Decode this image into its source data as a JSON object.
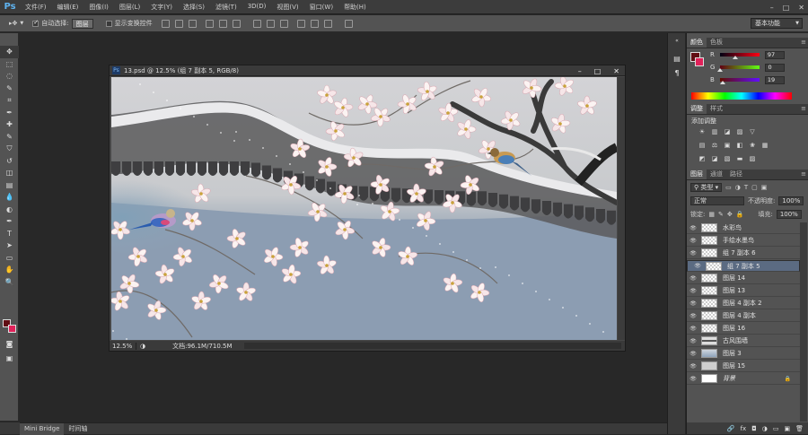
{
  "app": {
    "logo": "Ps"
  },
  "menu": [
    "文件(F)",
    "编辑(E)",
    "图像(I)",
    "图层(L)",
    "文字(Y)",
    "选择(S)",
    "滤镜(T)",
    "3D(D)",
    "视图(V)",
    "窗口(W)",
    "帮助(H)"
  ],
  "window_controls": {
    "minimize": "–",
    "maximize": "□",
    "close": "✕"
  },
  "options": {
    "auto_select_label": "自动选择:",
    "auto_select_value": "图层",
    "show_transform_label": "显示变换控件",
    "workspace": "基本功能"
  },
  "document": {
    "title": "13.psd @ 12.5% (组 7 副本 5, RGB/8)",
    "zoom": "12.5%",
    "info": "文档:96.1M/710.5M",
    "controls": {
      "minimize": "–",
      "maximize": "□",
      "close": "✕"
    }
  },
  "colors": {
    "foreground": "#610d13",
    "background": "#e0225a",
    "panel_bg": "#535353",
    "selected_layer": "#5b6b82"
  },
  "color_panel": {
    "tabs": [
      "颜色",
      "色板"
    ],
    "channels": [
      {
        "label": "R",
        "value": "97",
        "level": 0.38
      },
      {
        "label": "G",
        "value": "0",
        "level": 0.0
      },
      {
        "label": "B",
        "value": "19",
        "level": 0.07
      }
    ]
  },
  "adjust_panel": {
    "tabs": [
      "调整",
      "样式"
    ],
    "title": "添加调整",
    "row1": [
      "☀",
      "▥",
      "◪",
      "▨",
      "▽"
    ],
    "row2": [
      "▤",
      "⚖",
      "▣",
      "◧",
      "❀",
      "▦"
    ],
    "row3": [
      "◩",
      "◪",
      "▧",
      "▬",
      "▨"
    ]
  },
  "layers_panel": {
    "tabs": [
      "图层",
      "通道",
      "路径"
    ],
    "filter_label": "类型",
    "blend_mode": "正常",
    "opacity_label": "不透明度:",
    "opacity_value": "100%",
    "lock_label": "锁定:",
    "fill_label": "填充:",
    "fill_value": "100%",
    "layers": [
      {
        "name": "水彩鸟",
        "selected": false,
        "thumb": "checker"
      },
      {
        "name": "手绘水墨鸟",
        "selected": false,
        "thumb": "checker"
      },
      {
        "name": "组 7 副本 6",
        "selected": false,
        "thumb": "checker"
      },
      {
        "name": "组 7 副本 5",
        "selected": true,
        "thumb": "checker"
      },
      {
        "name": "图层 14",
        "selected": false,
        "thumb": "checker"
      },
      {
        "name": "图层 13",
        "selected": false,
        "thumb": "checker"
      },
      {
        "name": "图层 4 副本 2",
        "selected": false,
        "thumb": "checker"
      },
      {
        "name": "图层 4 副本",
        "selected": false,
        "thumb": "checker"
      },
      {
        "name": "图层 16",
        "selected": false,
        "thumb": "checker"
      },
      {
        "name": "古风围墙",
        "selected": false,
        "thumb": "wall"
      },
      {
        "name": "图层 3",
        "selected": false,
        "thumb": "blue"
      },
      {
        "name": "图层 15",
        "selected": false,
        "thumb": "gray"
      },
      {
        "name": "背景",
        "selected": false,
        "thumb": "white",
        "italic": true,
        "locked": true
      }
    ],
    "bottom_icons": [
      "🔗",
      "fx",
      "◘",
      "◑",
      "▭",
      "▣",
      "🗑"
    ]
  },
  "bottom_tabs": [
    "Mini Bridge",
    "时间轴"
  ],
  "toolbar": {
    "tools": [
      "move-tool",
      "marquee-tool",
      "lasso-tool",
      "quick-select-tool",
      "crop-tool",
      "eyedropper-tool",
      "healing-tool",
      "brush-tool",
      "stamp-tool",
      "history-brush-tool",
      "eraser-tool",
      "gradient-tool",
      "blur-tool",
      "dodge-tool",
      "pen-tool",
      "type-tool",
      "path-select-tool",
      "shape-tool",
      "hand-tool",
      "zoom-tool"
    ],
    "glyphs": [
      "✥",
      "⬚",
      "◌",
      "✎",
      "⌗",
      "✒",
      "✚",
      "✎",
      "⛉",
      "↺",
      "◫",
      "▤",
      "💧",
      "◐",
      "✒",
      "T",
      "➤",
      "▭",
      "✋",
      "🔍"
    ]
  }
}
